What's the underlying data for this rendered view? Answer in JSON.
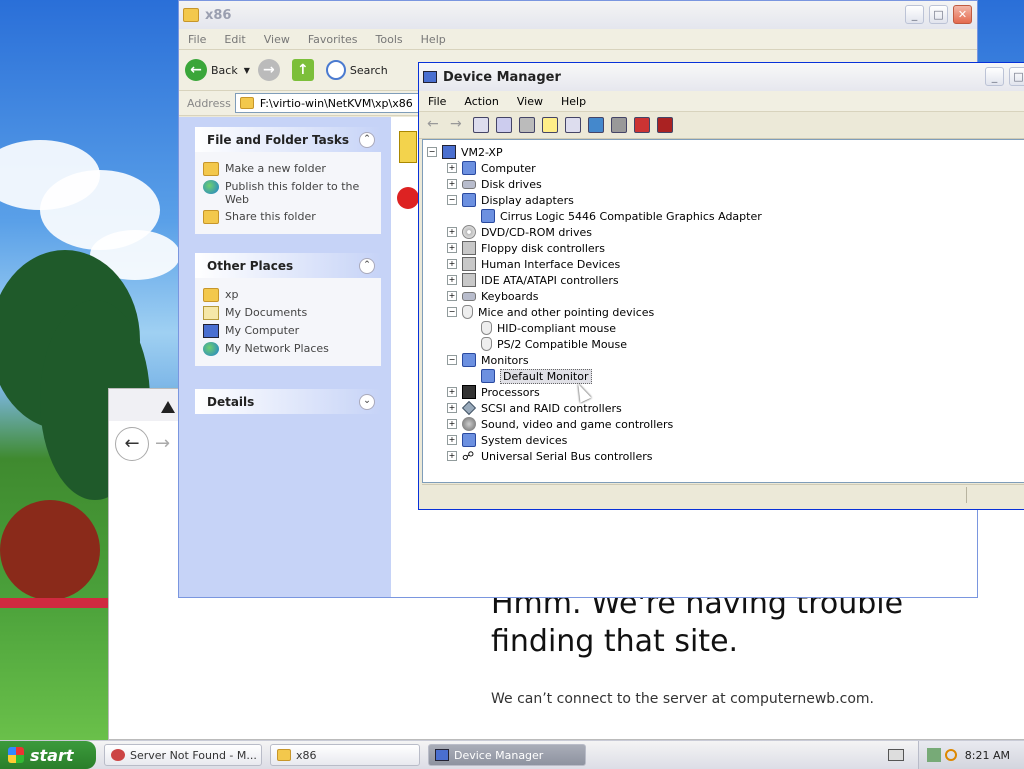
{
  "explorer": {
    "title": "x86",
    "menu": [
      "File",
      "Edit",
      "View",
      "Favorites",
      "Tools",
      "Help"
    ],
    "back_label": "Back",
    "search_label": "Search",
    "address_label": "Address",
    "address_value": "F:\\virtio-win\\NetKVM\\xp\\x86",
    "file_tasks": {
      "title": "File and Folder Tasks",
      "items": [
        "Make a new folder",
        "Publish this folder to the Web",
        "Share this folder"
      ]
    },
    "other_places": {
      "title": "Other Places",
      "items": [
        "xp",
        "My Documents",
        "My Computer",
        "My Network Places"
      ]
    },
    "details_title": "Details"
  },
  "browser": {
    "error_title": "Hmm. We're having trouble finding that site.",
    "error_text": "We can’t connect to the server at computernewb.com."
  },
  "device_manager": {
    "title": "Device Manager",
    "menu": [
      "File",
      "Action",
      "View",
      "Help"
    ],
    "tree": {
      "root": "VM2-XP",
      "items": [
        {
          "label": "Computer",
          "icon": "computer-icon",
          "expanded": false
        },
        {
          "label": "Disk drives",
          "icon": "disk-icon",
          "expanded": false
        },
        {
          "label": "Display adapters",
          "icon": "display-icon",
          "expanded": true,
          "children": [
            "Cirrus Logic 5446 Compatible Graphics Adapter"
          ]
        },
        {
          "label": "DVD/CD-ROM drives",
          "icon": "dvd-icon",
          "expanded": false
        },
        {
          "label": "Floppy disk controllers",
          "icon": "floppy-icon",
          "expanded": false
        },
        {
          "label": "Human Interface Devices",
          "icon": "hid-icon",
          "expanded": false
        },
        {
          "label": "IDE ATA/ATAPI controllers",
          "icon": "ide-icon",
          "expanded": false
        },
        {
          "label": "Keyboards",
          "icon": "keyboard-icon",
          "expanded": false
        },
        {
          "label": "Mice and other pointing devices",
          "icon": "mouse-icon",
          "expanded": true,
          "children": [
            "HID-compliant mouse",
            "PS/2 Compatible Mouse"
          ]
        },
        {
          "label": "Monitors",
          "icon": "monitor-icon",
          "expanded": true,
          "children": [
            "Default Monitor"
          ]
        },
        {
          "label": "Processors",
          "icon": "cpu-icon",
          "expanded": false
        },
        {
          "label": "SCSI and RAID controllers",
          "icon": "scsi-icon",
          "expanded": false
        },
        {
          "label": "Sound, video and game controllers",
          "icon": "sound-icon",
          "expanded": false
        },
        {
          "label": "System devices",
          "icon": "system-icon",
          "expanded": false
        },
        {
          "label": "Universal Serial Bus controllers",
          "icon": "usb-icon",
          "expanded": false
        }
      ],
      "selected": "Default Monitor"
    }
  },
  "taskbar": {
    "start_label": "start",
    "tasks": [
      "Server Not Found - M...",
      "x86",
      "Device Manager"
    ],
    "active_task": "Device Manager",
    "clock": "8:21 AM"
  }
}
